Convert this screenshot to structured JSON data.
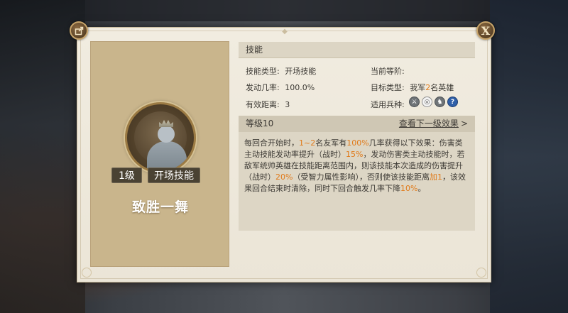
{
  "buttons": {
    "close_label": "X"
  },
  "skill_card": {
    "level": "1级",
    "type": "开场技能",
    "name": "致胜一舞"
  },
  "section": {
    "title": "技能"
  },
  "info": {
    "skill_type_label": "技能类型:",
    "skill_type_value": "开场技能",
    "current_level_label": "当前等阶:",
    "trigger_label": "发动几率:",
    "trigger_value": "100.0%",
    "target_label": "目标类型:",
    "target_value_pre": "我军",
    "target_value_num": "2",
    "target_value_post": "名英雄",
    "range_label": "有效距离:",
    "range_value": "3",
    "troops_label": "适用兵种:",
    "troop_icons": [
      "sword-icon",
      "shield-icon",
      "horse-icon",
      "question-icon"
    ]
  },
  "level_section": {
    "title": "等级10",
    "next_effect": "查看下一级效果",
    "description": {
      "p1": "每回合开始时，",
      "h1": "1~2",
      "p2": "名友军有",
      "h2": "100%",
      "p3": "几率获得以下效果：伤害类主动技能发动率提升（战时）",
      "h3": "15%",
      "p4": "，发动伤害类主动技能时，若敌军统帅英雄在技能距离范围内，则该技能本次造成的伤害提升（战时）",
      "h4": "20%",
      "p5": "（受智力属性影响），否则使该技能距离",
      "h5": "加1",
      "p6": "，该效果回合结束时清除，同时下回合触发几率下降",
      "h6": "10%",
      "p7": "。"
    }
  },
  "colors": {
    "highlight": "#e07a1a",
    "panel_bg": "#f1ece0",
    "card_bg": "#c9b58c"
  }
}
